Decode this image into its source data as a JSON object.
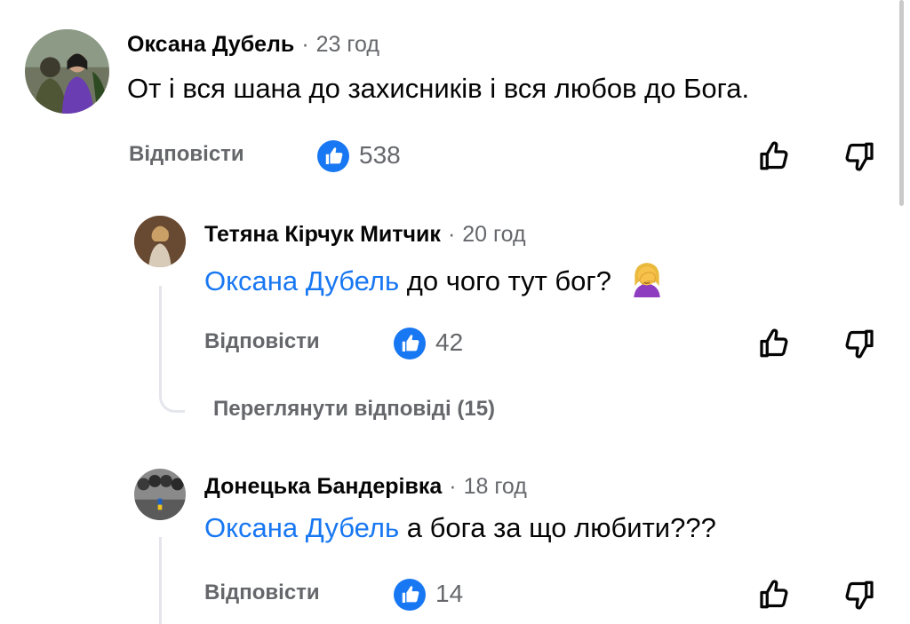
{
  "comments": [
    {
      "author": "Оксана Дубель",
      "time": "23 год",
      "text": "От і вся шана до захисників і вся любов до Бога.",
      "reply_label": "Відповісти",
      "like_count": "538"
    },
    {
      "author": "Тетяна Кірчук Митчик",
      "time": "20 год",
      "mention": "Оксана Дубель",
      "text": "до чого тут бог?",
      "emoji": "woman-facepalming-icon",
      "reply_label": "Відповісти",
      "like_count": "42",
      "view_replies": "Переглянути відповіді (15)"
    },
    {
      "author": "Донецька Бандерівка",
      "time": "18 год",
      "mention": "Оксана Дубель",
      "text": "а бога за що любити???",
      "reply_label": "Відповісти",
      "like_count": "14"
    }
  ],
  "separator": "·",
  "colors": {
    "link": "#1877f2",
    "secondary_text": "#65676b",
    "like_badge": "#1877f2",
    "thread_line": "#e4e6eb"
  }
}
